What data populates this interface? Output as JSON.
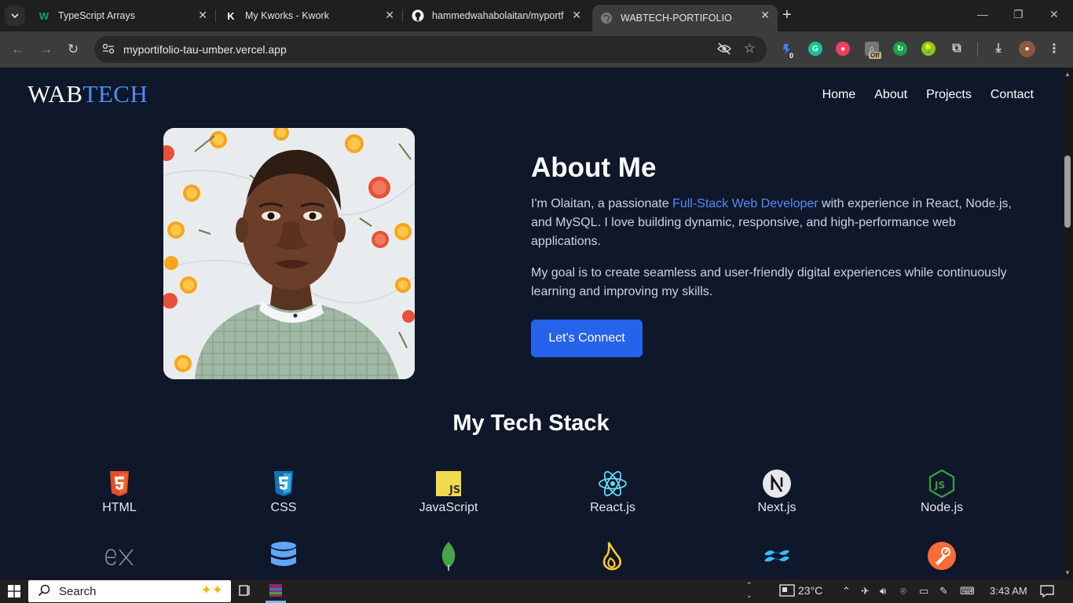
{
  "browser": {
    "tabs": [
      {
        "title": "TypeScript Arrays",
        "favicon": "w3schools-icon",
        "active": false
      },
      {
        "title": "My Kworks - Kwork",
        "favicon": "kwork-icon",
        "active": false
      },
      {
        "title": "hammedwahabolaitan/myportfolio",
        "favicon": "github-icon",
        "active": false
      },
      {
        "title": "WABTECH-PORTIFOLIO",
        "favicon": "globe-icon",
        "active": true
      }
    ],
    "url": "myportifolio-tau-umber.vercel.app",
    "ext_badge_off": "Off",
    "ext_badge_zero": "0"
  },
  "site": {
    "logo_main": "WAB",
    "logo_accent": "TECH",
    "nav": [
      "Home",
      "About",
      "Projects",
      "Contact"
    ]
  },
  "about": {
    "title": "About Me",
    "p1_before": "I'm Olaitan, a passionate ",
    "p1_highlight": "Full-Stack Web Developer",
    "p1_after": " with experience in React, Node.js, and MySQL. I love building dynamic, responsive, and high-performance web applications.",
    "p2": "My goal is to create seamless and user-friendly digital experiences while continuously learning and improving my skills.",
    "cta": "Let's Connect"
  },
  "stack": {
    "title": "My Tech Stack",
    "row1": [
      {
        "label": "HTML",
        "icon": "html5-icon"
      },
      {
        "label": "CSS",
        "icon": "css3-icon"
      },
      {
        "label": "JavaScript",
        "icon": "javascript-icon"
      },
      {
        "label": "React.js",
        "icon": "react-icon"
      },
      {
        "label": "Next.js",
        "icon": "nextjs-icon"
      },
      {
        "label": "Node.js",
        "icon": "nodejs-icon"
      }
    ],
    "row2_icons": [
      "express-icon",
      "database-icon",
      "mongodb-icon",
      "firebase-icon",
      "tailwind-icon",
      "postman-icon"
    ]
  },
  "taskbar": {
    "search": "Search",
    "temp": "23°C",
    "time": "3:43 AM"
  },
  "colors": {
    "page_bg": "#0f172a",
    "accent": "#4f8cf7",
    "button": "#2563eb"
  }
}
